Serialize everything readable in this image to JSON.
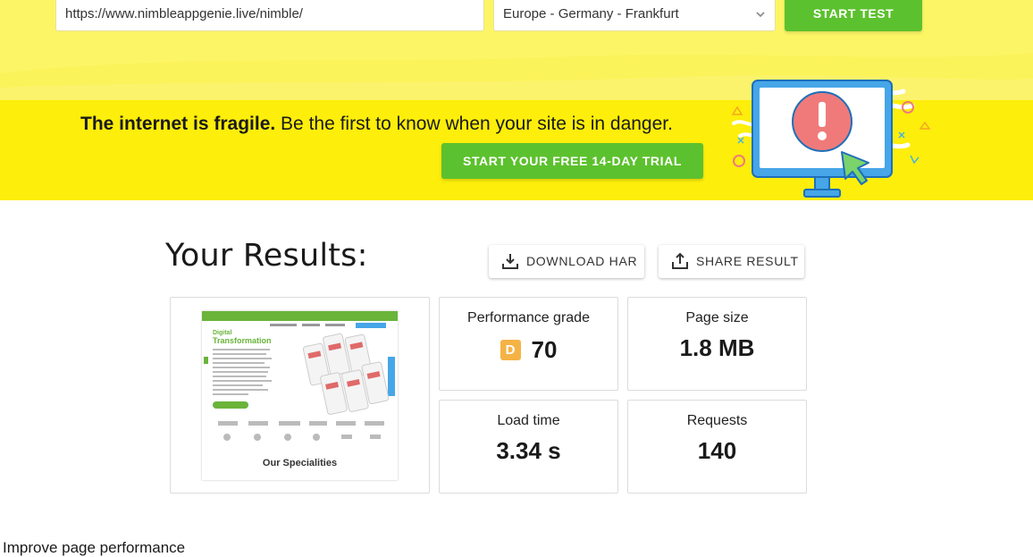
{
  "search": {
    "url_value": "https://www.nimbleappgenie.live/nimble/",
    "region_value": "Europe - Germany - Frankfurt",
    "start_label": "START TEST"
  },
  "promo": {
    "bold_text": "The internet is fragile.",
    "text": " Be the first to know when your site is in danger.",
    "trial_label": "START YOUR FREE 14-DAY TRIAL"
  },
  "results": {
    "title": "Your Results:",
    "download_label": "DOWNLOAD HAR",
    "share_label": "SHARE RESULT",
    "performance": {
      "label": "Performance grade",
      "grade": "D",
      "value": "70"
    },
    "page_size": {
      "label": "Page size",
      "value": "1.8 MB"
    },
    "load_time": {
      "label": "Load time",
      "value": "3.34 s"
    },
    "requests": {
      "label": "Requests",
      "value": "140"
    },
    "thumbnail": {
      "heading": "Transformation",
      "speciality": "Our Specialities"
    }
  },
  "improve": {
    "heading": "Improve page performance"
  },
  "colors": {
    "yellow_light": "#fcf565",
    "yellow_strip": "#fdee0b",
    "green": "#5cc12e",
    "grade_d": "#f5b346"
  },
  "icons": {
    "chevron": "chevron-down-icon",
    "download": "download-icon",
    "share": "share-icon",
    "alert": "alert-monitor-illustration"
  }
}
